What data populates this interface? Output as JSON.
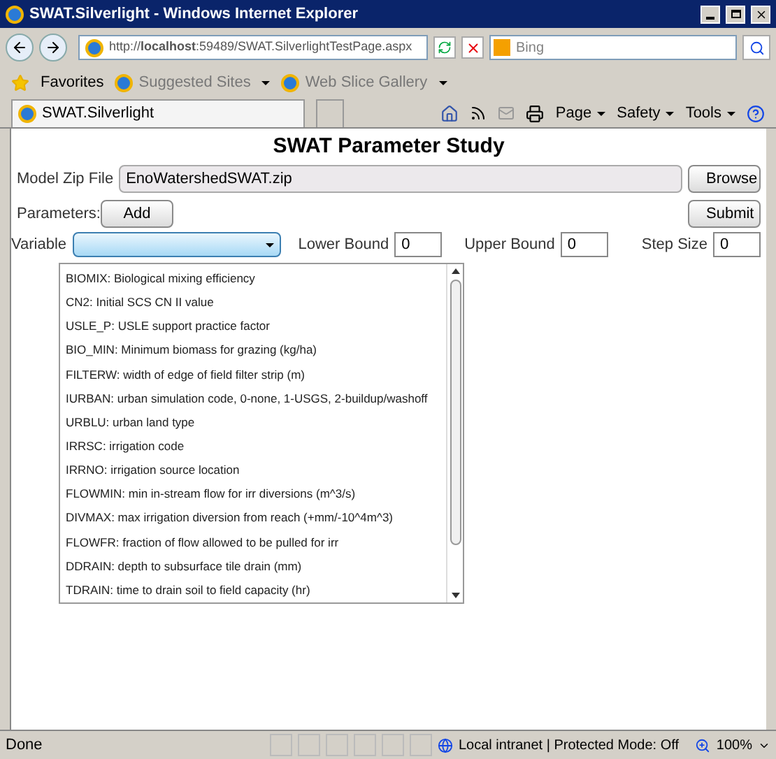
{
  "window": {
    "title": "SWAT.Silverlight - Windows Internet Explorer"
  },
  "address_bar": {
    "url": "http://**localhost**:59489/SWAT.SilverlightTestPage.aspx",
    "search_placeholder": "Bing"
  },
  "favorites_bar": {
    "label": "Favorites",
    "links": [
      "Suggested Sites",
      "Web Slice Gallery"
    ]
  },
  "tab": {
    "label": "SWAT.Silverlight"
  },
  "command_bar": {
    "menus": [
      "Page",
      "Safety",
      "Tools"
    ]
  },
  "page": {
    "heading": "SWAT Parameter Study",
    "model_zip": {
      "label": "Model Zip File",
      "value": "EnoWatershedSWAT.zip",
      "button": "Browse"
    },
    "parameters": {
      "label": "Parameters:",
      "add_button": "Add",
      "submit_button": "Submit"
    },
    "variable": {
      "label": "Variable",
      "expanded": true
    },
    "bounds": [
      {
        "label": "Lower Bound",
        "value": "0"
      },
      {
        "label": "Upper Bound",
        "value": "0"
      },
      {
        "label": "Step Size",
        "value": "0"
      }
    ],
    "dropdown_items": [
      "BIOMIX: Biological mixing efficiency",
      "CN2: Initial SCS CN II value",
      "USLE_P: USLE support practice factor",
      "BIO_MIN: Minimum biomass for grazing (kg/ha)",
      "FILTERW: width of edge of field filter strip (m)",
      "IURBAN: urban simulation code, 0-none, 1-USGS, 2-buildup/washoff",
      "URBLU: urban land type",
      "IRRSC: irrigation code",
      "IRRNO: irrigation source location",
      "FLOWMIN: min in-stream flow for irr diversions (m^3/s)",
      "DIVMAX: max irrigation diversion from reach (+mm/-10^4m^3)",
      "FLOWFR: fraction of flow allowed to be pulled for irr",
      "DDRAIN: depth to subsurface tile drain (mm)",
      "TDRAIN: time to drain soil to field capacity (hr)"
    ]
  },
  "status_bar": {
    "status": "Done",
    "zone": "Local intranet | Protected Mode: Off",
    "zoom": "100%"
  }
}
